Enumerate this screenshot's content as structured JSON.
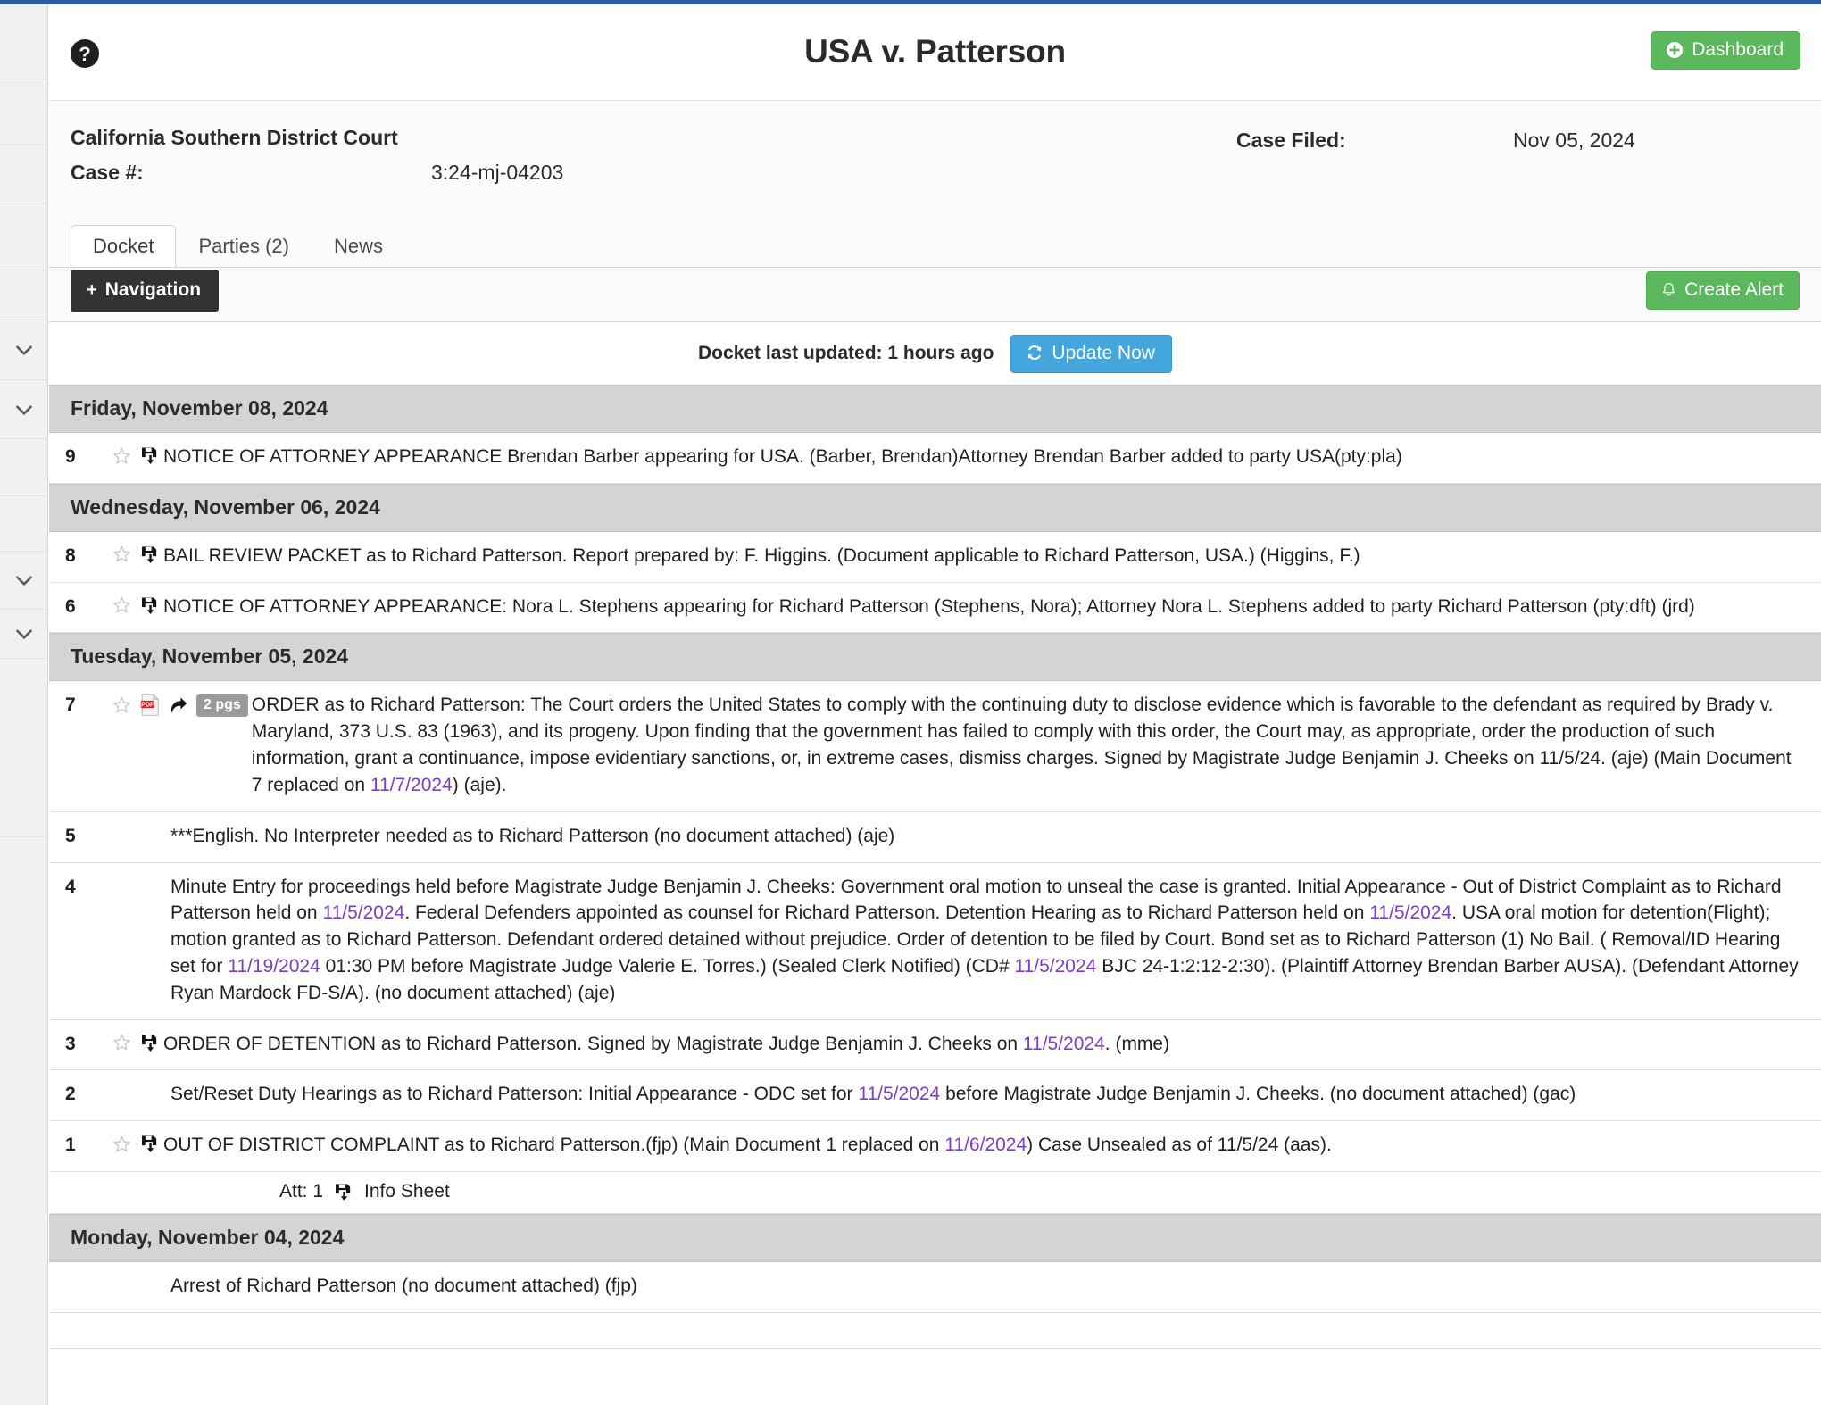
{
  "browser": {
    "accent_color": "#2d5b9e"
  },
  "sidebar": {
    "icons": [
      "chevron-down",
      "chevron-down",
      "chevron-down",
      "chevron-down"
    ]
  },
  "header": {
    "help_icon": "help-circle-icon",
    "title": "USA v. Patterson",
    "dashboard_label": "Dashboard",
    "dashboard_icon": "plus-circle-icon",
    "dashboard_color": "#5cb85c"
  },
  "case": {
    "court": "California Southern District Court",
    "case_number_label": "Case #:",
    "case_number": "3:24-mj-04203",
    "case_filed_label": "Case Filed:",
    "case_filed": "Nov 05, 2024"
  },
  "tabs": [
    {
      "label": "Docket",
      "active": true
    },
    {
      "label": "Parties (2)",
      "active": false
    },
    {
      "label": "News",
      "active": false
    }
  ],
  "actions": {
    "navigation_label": "Navigation",
    "navigation_icon": "plus-icon",
    "create_alert_label": "Create Alert",
    "create_alert_icon": "bell-icon",
    "create_alert_color": "#5cb85c"
  },
  "update": {
    "status_text": "Docket last updated: 1 hours ago",
    "button_label": "Update Now",
    "button_icon": "refresh-icon",
    "button_color": "#43a6dd"
  },
  "docket": {
    "link_color": "#7b3fc4",
    "groups": [
      {
        "date": "Friday, November 08, 2024",
        "entries": [
          {
            "num": "9",
            "icons": [
              "star-icon",
              "save-icon"
            ],
            "segments": [
              {
                "t": "NOTICE OF ATTORNEY APPEARANCE Brendan Barber appearing for USA. (Barber, Brendan)Attorney Brendan Barber added to party USA(pty:pla)"
              }
            ]
          }
        ]
      },
      {
        "date": "Wednesday, November 06, 2024",
        "entries": [
          {
            "num": "8",
            "icons": [
              "star-icon",
              "save-icon"
            ],
            "segments": [
              {
                "t": "BAIL REVIEW PACKET as to Richard Patterson. Report prepared by: F. Higgins. (Document applicable to Richard Patterson, USA.) (Higgins, F.)"
              }
            ]
          },
          {
            "num": "6",
            "icons": [
              "star-icon",
              "save-icon"
            ],
            "segments": [
              {
                "t": "NOTICE OF ATTORNEY APPEARANCE: Nora L. Stephens appearing for Richard Patterson (Stephens, Nora); Attorney Nora L. Stephens added to party Richard Patterson (pty:dft) (jrd)"
              }
            ]
          }
        ]
      },
      {
        "date": "Tuesday, November 05, 2024",
        "entries": [
          {
            "num": "7",
            "icons": [
              "star-icon",
              "pdf-icon",
              "share-icon"
            ],
            "badge": "2 pgs",
            "segments": [
              {
                "t": "ORDER as to Richard Patterson: The Court orders the United States to comply with the continuing duty to disclose evidence which is favorable to the defendant as required by Brady v. Maryland, 373 U.S. 83 (1963), and its progeny. Upon finding that the government has failed to comply with this order, the Court may, as appropriate, order the production of such information, grant a continuance, impose evidentiary sanctions, or, in extreme cases, dismiss charges. Signed by Magistrate Judge Benjamin J. Cheeks on 11/5/24. (aje) (Main Document 7 replaced on "
              },
              {
                "t": "11/7/2024",
                "link": true
              },
              {
                "t": ") (aje)."
              }
            ]
          },
          {
            "num": "5",
            "icons": [],
            "segments": [
              {
                "t": "***English. No Interpreter needed as to Richard Patterson (no document attached) (aje)"
              }
            ]
          },
          {
            "num": "4",
            "icons": [],
            "segments": [
              {
                "t": " Minute Entry for proceedings held before Magistrate Judge Benjamin J. Cheeks: Government oral motion to unseal the case is granted. Initial Appearance - Out of District Complaint as to Richard Patterson held on "
              },
              {
                "t": "11/5/2024",
                "link": true
              },
              {
                "t": ". Federal Defenders appointed as counsel for Richard Patterson. Detention Hearing as to Richard Patterson held on "
              },
              {
                "t": "11/5/2024",
                "link": true
              },
              {
                "t": ". USA oral motion for detention(Flight); motion granted as to Richard Patterson. Defendant ordered detained without prejudice. Order of detention to be filed by Court. Bond set as to Richard Patterson (1) No Bail. ( Removal/ID Hearing set for "
              },
              {
                "t": "11/19/2024",
                "link": true
              },
              {
                "t": " 01:30 PM before Magistrate Judge Valerie E. Torres.) (Sealed Clerk Notified) (CD# "
              },
              {
                "t": "11/5/2024",
                "link": true
              },
              {
                "t": " BJC 24-1:2:12-2:30). (Plaintiff Attorney Brendan Barber AUSA). (Defendant Attorney Ryan Mardock FD-S/A). (no document attached) (aje)"
              }
            ]
          },
          {
            "num": "3",
            "icons": [
              "star-icon",
              "save-icon"
            ],
            "segments": [
              {
                "t": "ORDER OF DETENTION as to Richard Patterson. Signed by Magistrate Judge Benjamin J. Cheeks on "
              },
              {
                "t": "11/5/2024",
                "link": true
              },
              {
                "t": ". (mme)"
              }
            ]
          },
          {
            "num": "2",
            "icons": [],
            "segments": [
              {
                "t": "Set/Reset Duty Hearings as to Richard Patterson: Initial Appearance - ODC set for "
              },
              {
                "t": "11/5/2024",
                "link": true
              },
              {
                "t": " before Magistrate Judge Benjamin J. Cheeks. (no document attached) (gac)"
              }
            ]
          },
          {
            "num": "1",
            "icons": [
              "star-icon",
              "save-icon"
            ],
            "segments": [
              {
                "t": "OUT OF DISTRICT COMPLAINT as to Richard Patterson.(fjp) (Main Document 1 replaced on "
              },
              {
                "t": "11/6/2024",
                "link": true
              },
              {
                "t": ") Case Unsealed as of 11/5/24 (aas)."
              }
            ],
            "attachment": {
              "label": "Att: 1",
              "icon": "save-icon",
              "name": "Info Sheet"
            }
          }
        ]
      },
      {
        "date": "Monday, November 04, 2024",
        "entries": [
          {
            "num": "",
            "icons": [],
            "segments": [
              {
                "t": "Arrest of Richard Patterson (no document attached) (fjp)"
              }
            ]
          }
        ]
      }
    ]
  }
}
